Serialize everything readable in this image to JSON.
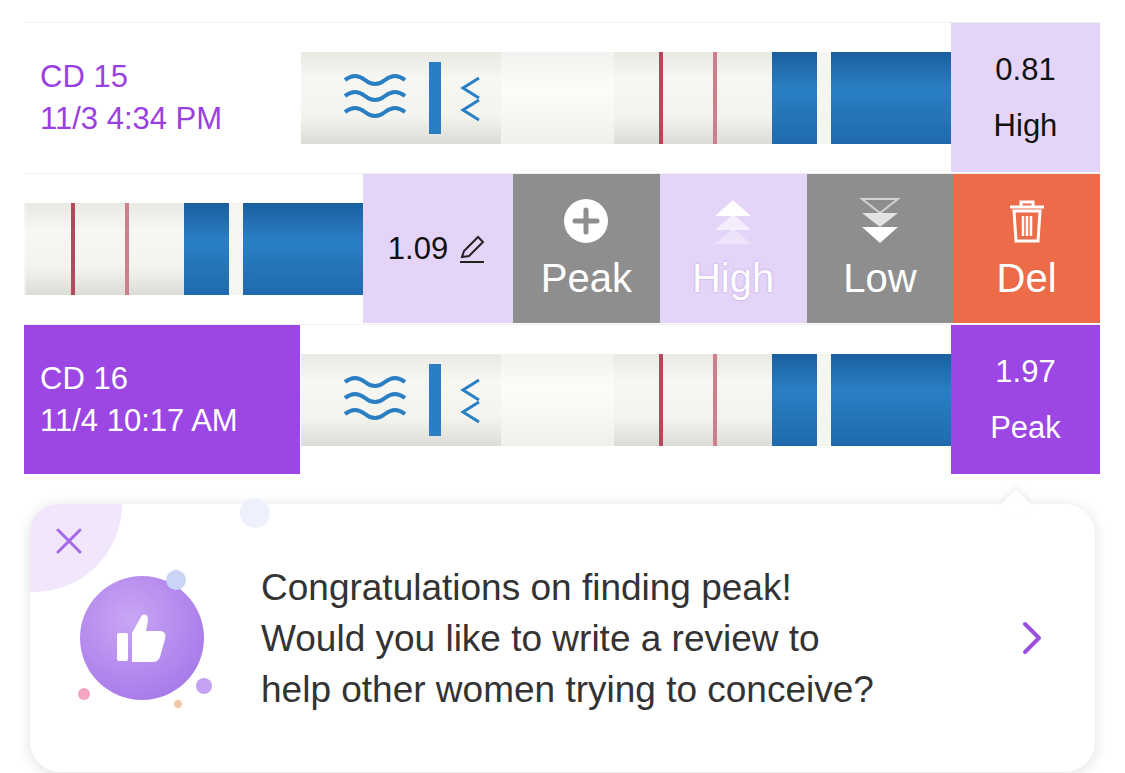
{
  "readings": [
    {
      "kind": "reading",
      "day": "CD 15",
      "time": "11/3 4:34 PM",
      "value": "0.81",
      "result": "High",
      "peak": false
    },
    {
      "kind": "swiped",
      "value": "1.09",
      "editable": true,
      "actions": [
        {
          "label": "Peak",
          "kind": "peak",
          "selected": false
        },
        {
          "label": "High",
          "kind": "high",
          "selected": true
        },
        {
          "label": "Low",
          "kind": "low",
          "selected": false
        },
        {
          "label": "Del",
          "kind": "delete",
          "selected": false
        }
      ]
    },
    {
      "kind": "reading",
      "day": "CD 16",
      "time": "11/4 10:17 AM",
      "value": "1.97",
      "result": "Peak",
      "peak": true
    }
  ],
  "prompt": {
    "lines": [
      "Congratulations on finding peak!",
      "Would you like to write a review to",
      "help other women trying to conceive?"
    ]
  }
}
